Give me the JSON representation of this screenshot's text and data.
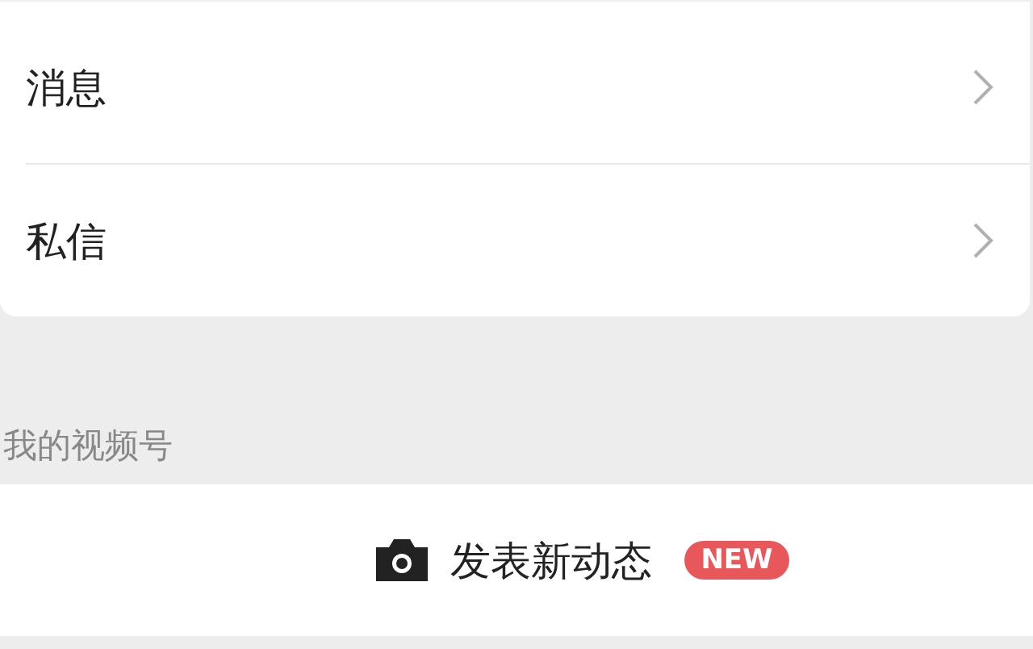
{
  "menu": [
    {
      "label": "消息"
    },
    {
      "label": "私信"
    }
  ],
  "section": {
    "title": "我的视频号"
  },
  "post": {
    "label": "发表新动态",
    "badge": "NEW"
  }
}
